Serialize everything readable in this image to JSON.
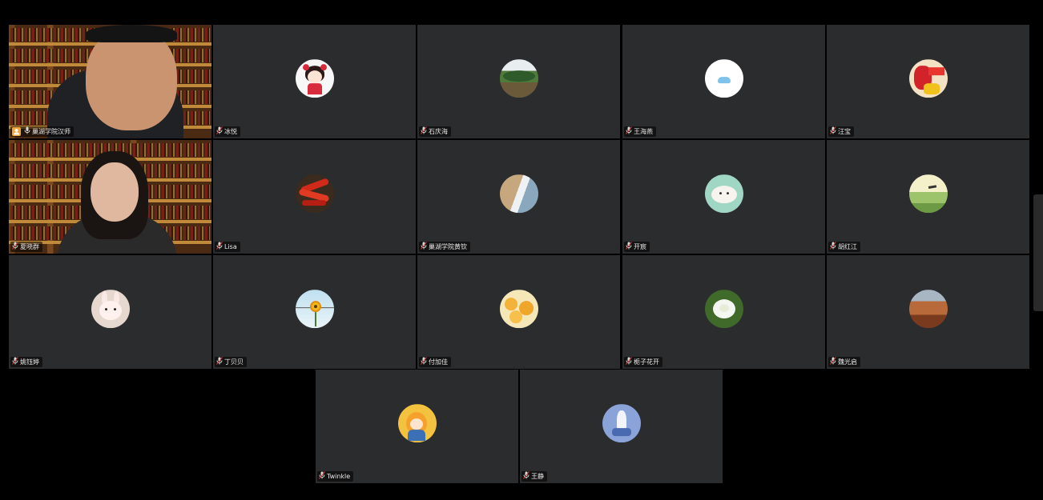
{
  "participants": [
    {
      "name": "巢湖学院汉师",
      "type": "video",
      "host": true,
      "active": true
    },
    {
      "name": "冰悦",
      "type": "avatar",
      "avatar": "cartoon-girl"
    },
    {
      "name": "石庆海",
      "type": "avatar",
      "avatar": "landscape"
    },
    {
      "name": "王海燕",
      "type": "avatar",
      "avatar": "cloud"
    },
    {
      "name": "汪宝",
      "type": "avatar",
      "avatar": "festival"
    },
    {
      "name": "夏晓群",
      "type": "video",
      "host": false
    },
    {
      "name": "Lisa",
      "type": "avatar",
      "avatar": "chili"
    },
    {
      "name": "巢湖学院黄钦",
      "type": "avatar",
      "avatar": "coast"
    },
    {
      "name": "开宸",
      "type": "avatar",
      "avatar": "puppy"
    },
    {
      "name": "胡红江",
      "type": "avatar",
      "avatar": "bird-painting"
    },
    {
      "name": "姚钰婷",
      "type": "avatar",
      "avatar": "plush-bunny"
    },
    {
      "name": "丁贝贝",
      "type": "avatar",
      "avatar": "sunflower"
    },
    {
      "name": "付加佳",
      "type": "avatar",
      "avatar": "yellow-flowers"
    },
    {
      "name": "栀子花开",
      "type": "avatar",
      "avatar": "white-flower"
    },
    {
      "name": "魏光启",
      "type": "avatar",
      "avatar": "canyon"
    },
    {
      "name": "Twinkle",
      "type": "avatar",
      "avatar": "anime-girl"
    },
    {
      "name": "王静",
      "type": "avatar",
      "avatar": "blue-illustration"
    }
  ]
}
